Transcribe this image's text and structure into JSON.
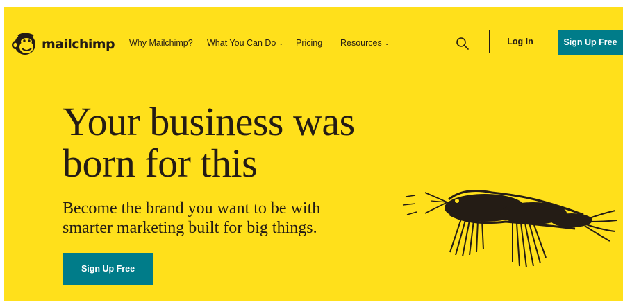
{
  "brand": {
    "name": "mailchimp"
  },
  "nav": {
    "items": [
      {
        "label": "Why Mailchimp?",
        "has_dropdown": false
      },
      {
        "label": "What You Can Do",
        "has_dropdown": true
      },
      {
        "label": "Pricing",
        "has_dropdown": false
      },
      {
        "label": "Resources",
        "has_dropdown": true
      }
    ],
    "search_icon": "search-icon",
    "login_label": "Log In",
    "signup_label": "Sign Up Free"
  },
  "hero": {
    "headline_line1": "Your business was",
    "headline_line2": "born for this",
    "subhead_line1": "Become the brand you want to be with",
    "subhead_line2": "smarter marketing built for big things.",
    "cta_label": "Sign Up Free",
    "illustration": "scribbled-bird-illustration"
  },
  "colors": {
    "background": "#ffe01b",
    "accent": "#007c89",
    "text": "#241c15"
  }
}
